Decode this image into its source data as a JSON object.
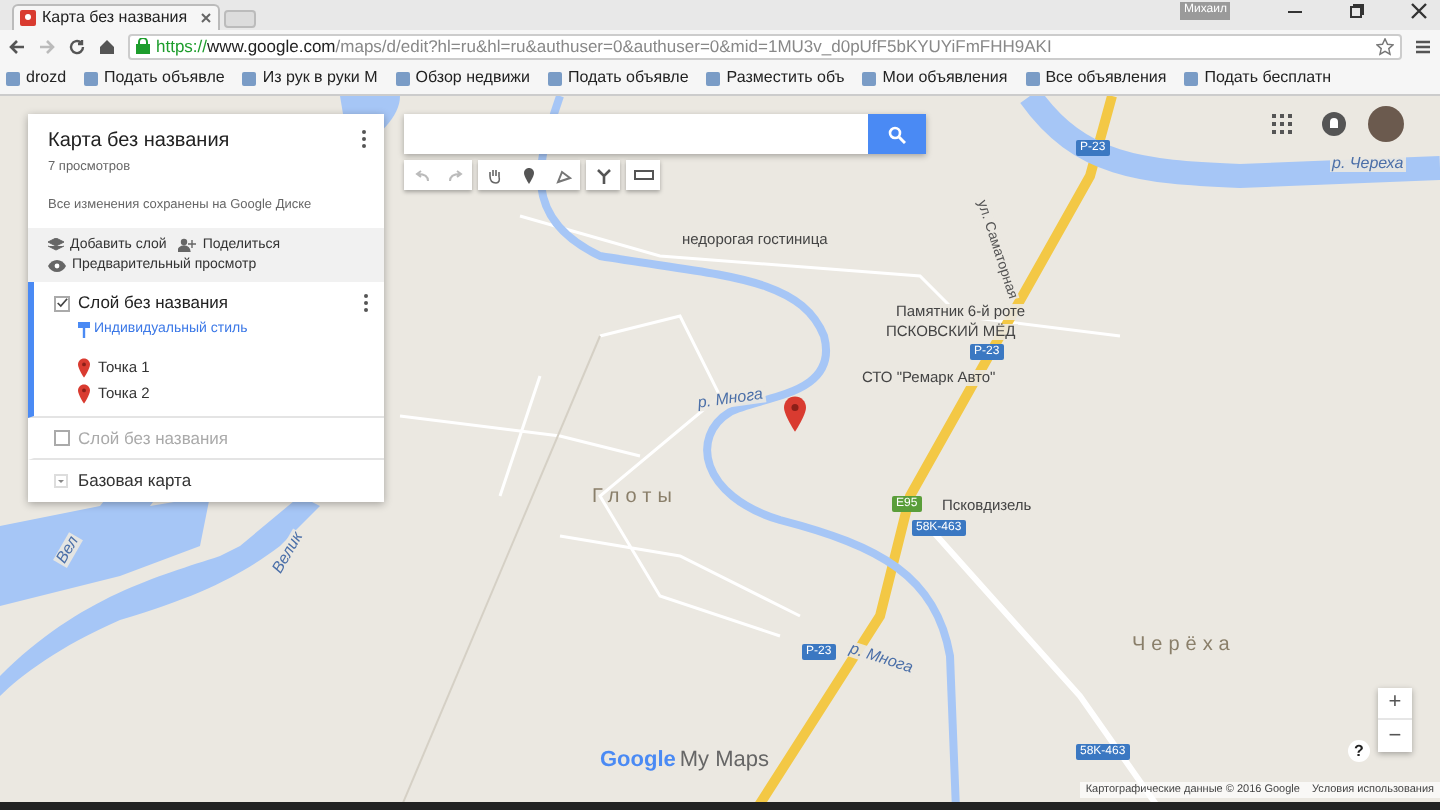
{
  "browser": {
    "tab_title": "Карта без названия",
    "profile": "Михаил",
    "url": {
      "scheme": "https://",
      "host": "www.google.com",
      "path": "/maps/d/edit?hl=ru&hl=ru&authuser=0&authuser=0&mid=1MU3v_d0pUfF5bKYUYiFmFHH9AKI"
    },
    "bookmarks": [
      {
        "label": "drozd"
      },
      {
        "label": "Подать объявле"
      },
      {
        "label": "Из рук в руки М"
      },
      {
        "label": "Обзор недвижи"
      },
      {
        "label": "Подать объявле"
      },
      {
        "label": "Разместить объ"
      },
      {
        "label": "Мои объявления"
      },
      {
        "label": "Все объявления"
      },
      {
        "label": "Подать бесплатн"
      }
    ]
  },
  "panel": {
    "title": "Карта без названия",
    "views": "7 просмотров",
    "status": "Все изменения сохранены на Google Диске",
    "actions": [
      {
        "kind": "layer",
        "label": "Добавить слой"
      },
      {
        "kind": "share",
        "label": "Поделиться"
      },
      {
        "kind": "preview",
        "label": "Предварительный просмотр"
      }
    ],
    "layers": [
      {
        "name": "Слой без названия",
        "checked": true,
        "selected": true,
        "style_link": "Индивидуальный стиль",
        "points": [
          "Точка 1",
          "Точка 2"
        ]
      },
      {
        "name": "Слой без названия",
        "checked": false,
        "selected": false
      }
    ],
    "base_map": "Базовая карта"
  },
  "map": {
    "labels": [
      {
        "kind": "poi",
        "text": "недорогая гостиница"
      },
      {
        "kind": "street",
        "text": "ул. Саматорная"
      },
      {
        "kind": "poi",
        "text": "Памятник 6-й роте"
      },
      {
        "kind": "poi",
        "text": "ПСКОВСКИЙ МЁД"
      },
      {
        "kind": "poi",
        "text": "СТО \"Ремарк Авто\""
      },
      {
        "kind": "river",
        "text": "р. Многа"
      },
      {
        "kind": "town",
        "text": "Глоты"
      },
      {
        "kind": "poi",
        "text": "Псковдизель"
      },
      {
        "kind": "river",
        "text": "р. Многа"
      },
      {
        "kind": "town",
        "text": "Черёха"
      },
      {
        "kind": "river",
        "text": "р. Череха"
      },
      {
        "kind": "river",
        "text": "Вел"
      },
      {
        "kind": "river",
        "text": "Велик"
      }
    ],
    "shields": [
      {
        "text": "P-23",
        "color": "#3b78c2"
      },
      {
        "text": "P-23",
        "color": "#3b78c2"
      },
      {
        "text": "E95",
        "color": "#5a9e3a"
      },
      {
        "text": "58K-463",
        "color": "#3b78c2"
      },
      {
        "text": "P-23",
        "color": "#3b78c2"
      },
      {
        "text": "58K-463",
        "color": "#3b78c2"
      }
    ],
    "zoom_in": "+",
    "zoom_out": "−",
    "help": "?",
    "logo_brand": "Google",
    "logo_product": "My Maps",
    "attribution": "Картографические данные © 2016 Google",
    "terms": "Условия использования"
  }
}
